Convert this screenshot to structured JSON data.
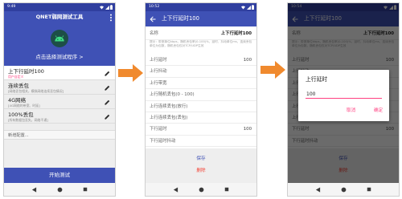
{
  "colors": {
    "primary": "#3F51B5",
    "primary_dark": "#303F9F",
    "accent": "#FF4081",
    "arrow": "#F08A2E",
    "danger": "#F44336"
  },
  "list_screen": {
    "status": {
      "time": "9:49",
      "icons": [
        "wifi-icon",
        "signal-icon",
        "battery-icon"
      ]
    },
    "app_title": "QNET弱网测试工具",
    "menu_icon": "more-vert-icon",
    "app_icon": "android-icon",
    "select_program": "点击选择测试程序 >",
    "profiles": [
      {
        "name": "上下行延时100",
        "desc": "用户自定义",
        "selected": true,
        "icon": "edit-icon"
      },
      {
        "name": "连续丢包",
        "desc": "[网络丢包相关，模拟网络连续丢包情况]",
        "selected": false,
        "icon": "edit-icon"
      },
      {
        "name": "4G网络",
        "desc": "[4G网络的带宽、时延]",
        "selected": false,
        "icon": "edit-icon"
      },
      {
        "name": "100%丢包",
        "desc": "[所有数据包丢失，网络不通]",
        "selected": false,
        "icon": "edit-icon"
      }
    ],
    "add_config": "新增配置...",
    "start_button": "开始测试",
    "nav": [
      "back-icon",
      "home-icon",
      "recents-icon"
    ]
  },
  "edit_screen": {
    "status": {
      "time": "10:52",
      "icons": [
        "wifi-icon",
        "signal-icon",
        "battery-icon"
      ]
    },
    "back_icon": "arrow-back-icon",
    "title": "上下行延时100",
    "name_label": "名称",
    "name_value": "上下行延时100",
    "hint": "提示：带宽单位kbps，随机丢包率(0-100)%，延时、抖动单位ms，连续丢包单位为包数，随机丢包仅对TCP/UDP生效",
    "params": [
      {
        "label": "上行延时",
        "value": "100"
      },
      {
        "label": "上行抖动"
      },
      {
        "label": "上行带宽"
      },
      {
        "label": "上行随机丢包(0 - 100)"
      },
      {
        "label": "上行连续丢包(放行)"
      },
      {
        "label": "上行连续丢包(丢包)"
      },
      {
        "label": "下行延时",
        "value": "100"
      },
      {
        "label": "下行延时抖动"
      }
    ],
    "save": "保存",
    "delete": "删除",
    "nav": [
      "back-icon",
      "home-icon",
      "recents-icon"
    ]
  },
  "dialog_screen": {
    "status": {
      "time": "10:54",
      "icons": [
        "wifi-icon",
        "signal-icon",
        "battery-icon"
      ]
    },
    "dialog": {
      "title": "上行延时",
      "value": "100",
      "cancel": "取消",
      "confirm": "确定"
    },
    "nav": [
      "back-icon",
      "home-icon",
      "recents-icon"
    ]
  }
}
